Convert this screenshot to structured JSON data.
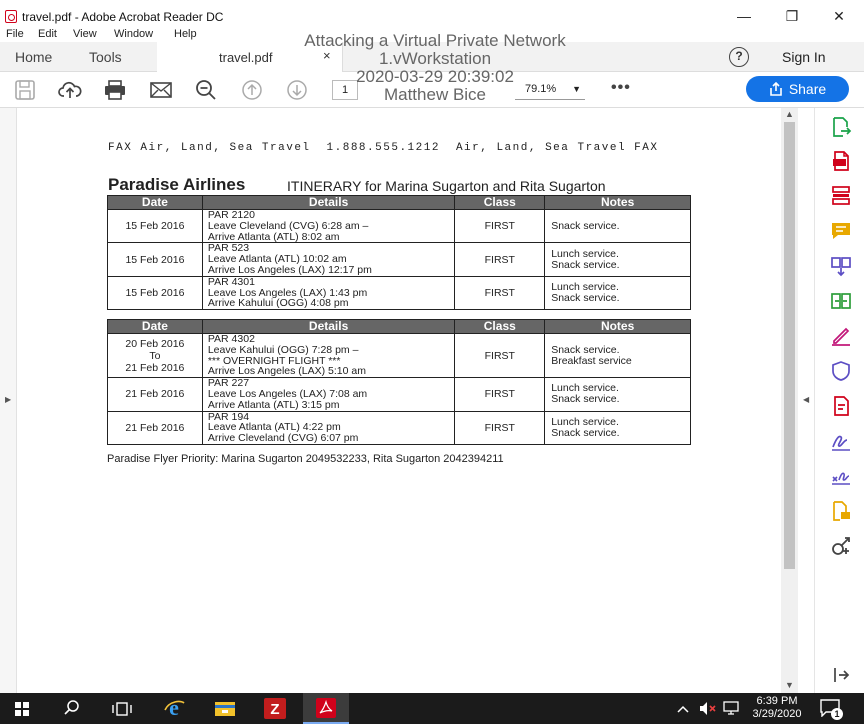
{
  "window": {
    "title": "travel.pdf - Adobe Acrobat Reader DC",
    "minimize": "—",
    "maximize": "❐",
    "close": "✕"
  },
  "menu": [
    "File",
    "Edit",
    "View",
    "Window",
    "Help"
  ],
  "tabs": {
    "home": "Home",
    "tools": "Tools",
    "doc": "travel.pdf",
    "doc_close": "×"
  },
  "header": {
    "help": "?",
    "signin": "Sign In"
  },
  "toolbar": {
    "page": "1",
    "zoom": "79.1%",
    "more": "•••",
    "share": "Share"
  },
  "overlay": [
    "Attacking a Virtual Private Network",
    "1.vWorkstation",
    "2020-03-29 20:39:02",
    "Matthew Bice"
  ],
  "document": {
    "fax_line": [
      "FAX Air, Land, Sea Travel",
      "1.888.555.1212",
      "Air, Land, Sea Travel FAX"
    ],
    "airline": "Paradise Airlines",
    "itinerary_title": "ITINERARY for Marina Sugarton and Rita Sugarton",
    "columns": [
      "Date",
      "Details",
      "Class",
      "Notes"
    ],
    "table1": [
      {
        "date": [
          "15 Feb 2016"
        ],
        "details": [
          "PAR 2120",
          "Leave Cleveland (CVG) 6:28 am –",
          "Arrive Atlanta (ATL) 8:02 am"
        ],
        "class": "FIRST",
        "notes": [
          "Snack service."
        ]
      },
      {
        "date": [
          "15 Feb 2016"
        ],
        "details": [
          "PAR 523",
          "Leave Atlanta (ATL) 10:02 am",
          "Arrive Los Angeles (LAX) 12:17 pm"
        ],
        "class": "FIRST",
        "notes": [
          "Lunch service.",
          "Snack service."
        ]
      },
      {
        "date": [
          "15 Feb 2016"
        ],
        "details": [
          "PAR 4301",
          "Leave Los Angeles (LAX) 1:43 pm",
          "Arrive Kahului (OGG) 4:08 pm"
        ],
        "class": "FIRST",
        "notes": [
          "Lunch service.",
          "Snack service."
        ]
      }
    ],
    "table2": [
      {
        "date": [
          "20 Feb 2016",
          "To",
          "21 Feb 2016"
        ],
        "details": [
          "PAR 4302",
          "Leave Kahului (OGG) 7:28 pm –",
          "*** OVERNIGHT FLIGHT ***",
          "Arrive Los Angeles (LAX) 5:10 am"
        ],
        "class": "FIRST",
        "notes": [
          "Snack service.",
          "Breakfast service"
        ]
      },
      {
        "date": [
          "21 Feb 2016"
        ],
        "details": [
          "PAR 227",
          "Leave Los Angeles (LAX) 7:08 am",
          "Arrive Atlanta (ATL) 3:15 pm"
        ],
        "class": "FIRST",
        "notes": [
          "Lunch service.",
          "Snack service."
        ]
      },
      {
        "date": [
          "21 Feb 2016"
        ],
        "details": [
          "PAR 194",
          "Leave Atlanta (ATL) 4:22 pm",
          "Arrive Cleveland (CVG) 6:07 pm"
        ],
        "class": "FIRST",
        "notes": [
          "Lunch service.",
          "Snack service."
        ]
      }
    ],
    "priority": "Paradise Flyer Priority: Marina Sugarton 2049532233, Rita Sugarton 2042394211"
  },
  "right_tools": [
    "export-pdf-icon",
    "create-pdf-icon",
    "organize-pages-icon",
    "comment-icon",
    "combine-files-icon",
    "compress-pdf-icon",
    "fill-sign-icon",
    "protect-icon",
    "edit-pdf-icon",
    "request-signatures-icon",
    "send-for-signature-icon",
    "send-for-review-icon",
    "more-tools-icon"
  ],
  "colors": {
    "accent": "#1473e6",
    "tool_red": "#d0021b",
    "tool_yellow": "#e8a800",
    "tool_purple": "#5c4ec4",
    "tool_green": "#2d9d3a",
    "table_header": "#666666",
    "taskbar": "#1b1b1b"
  },
  "taskbar": {
    "time": "6:39 PM",
    "date": "3/29/2020",
    "notify_count": "1"
  }
}
